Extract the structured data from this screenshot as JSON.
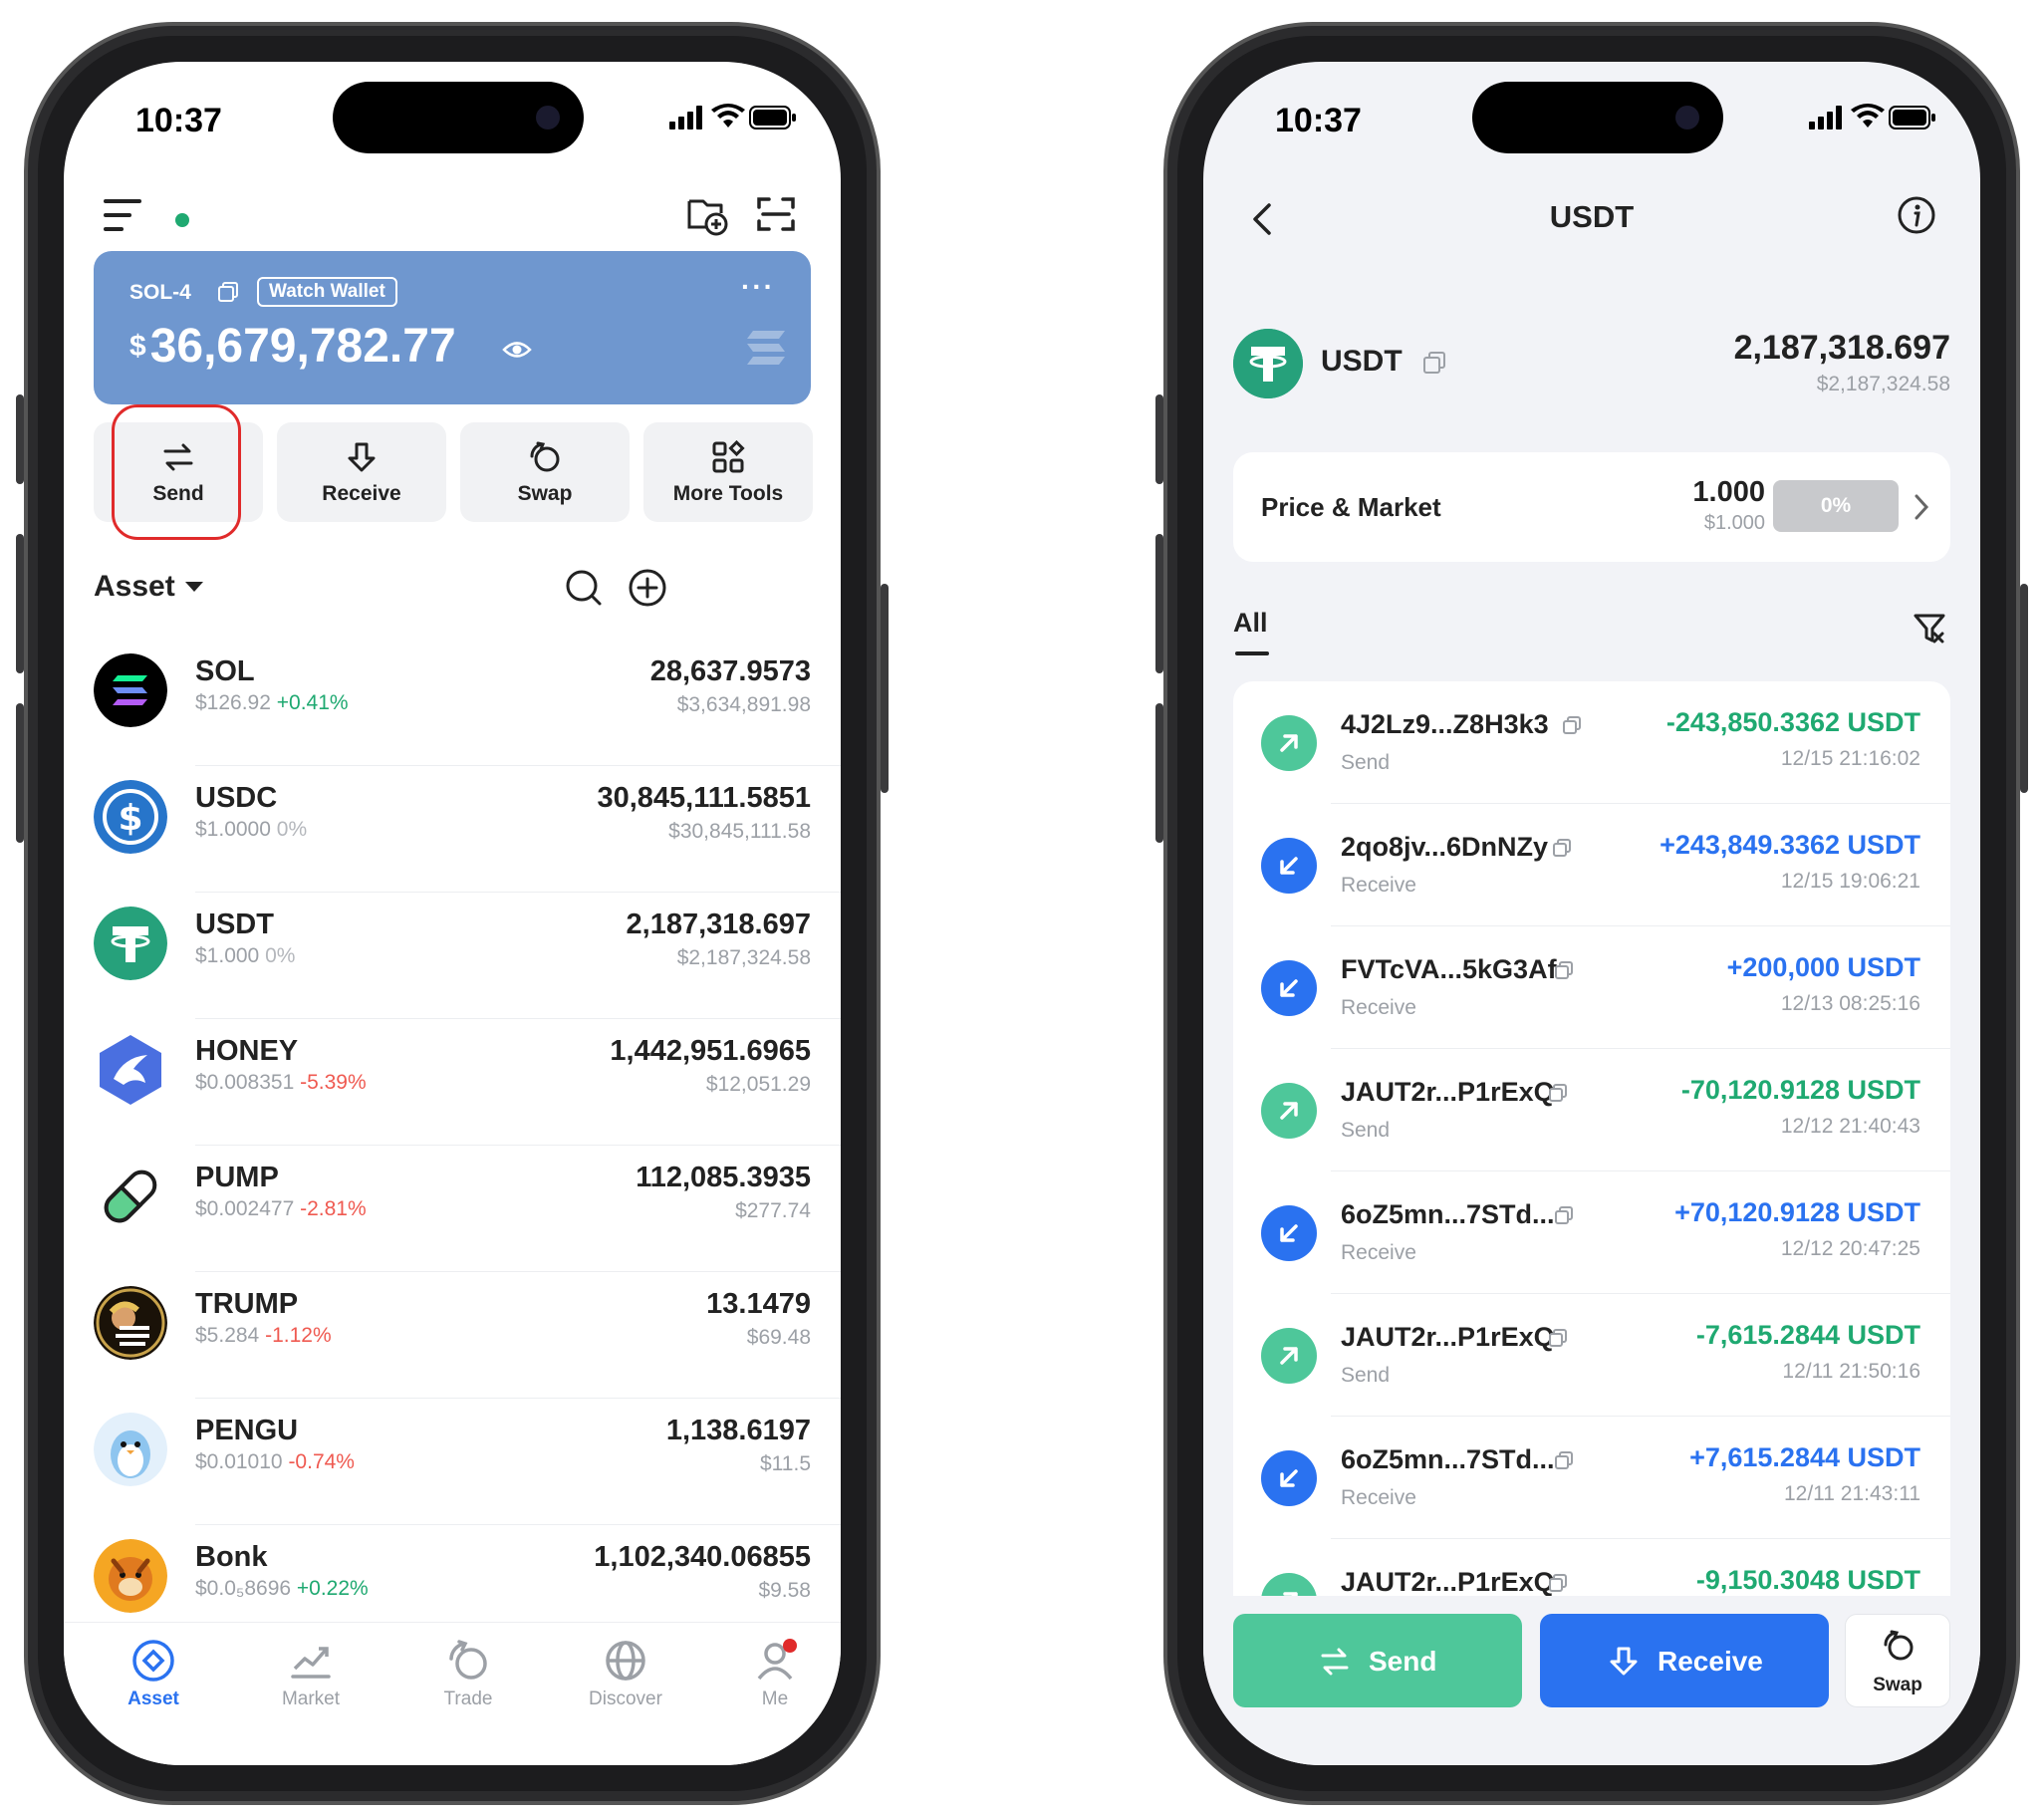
{
  "status_time": "10:37",
  "left": {
    "wallet": {
      "name": "SOL-4",
      "badge": "Watch Wallet",
      "more": "···",
      "currency": "$",
      "balance": "36,679,782.77"
    },
    "actions": [
      "Send",
      "Receive",
      "Swap",
      "More Tools"
    ],
    "asset_header": "Asset",
    "assets": [
      {
        "name": "SOL",
        "price": "$126.92",
        "change": "+0.41%",
        "dir": "pos",
        "amount": "28,637.9573",
        "value": "$3,634,891.98",
        "icon": "solana-icon"
      },
      {
        "name": "USDC",
        "price": "$1.0000",
        "change": "0%",
        "dir": "flat",
        "amount": "30,845,111.5851",
        "value": "$30,845,111.58",
        "icon": "usdc-icon"
      },
      {
        "name": "USDT",
        "price": "$1.000",
        "change": "0%",
        "dir": "flat",
        "amount": "2,187,318.697",
        "value": "$2,187,324.58",
        "icon": "tether-icon"
      },
      {
        "name": "HONEY",
        "price": "$0.008351",
        "change": "-5.39%",
        "dir": "neg",
        "amount": "1,442,951.6965",
        "value": "$12,051.29",
        "icon": "honey-icon"
      },
      {
        "name": "PUMP",
        "price": "$0.002477",
        "change": "-2.81%",
        "dir": "neg",
        "amount": "112,085.3935",
        "value": "$277.74",
        "icon": "pill-icon"
      },
      {
        "name": "TRUMP",
        "price": "$5.284",
        "change": "-1.12%",
        "dir": "neg",
        "amount": "13.1479",
        "value": "$69.48",
        "icon": "trump-icon"
      },
      {
        "name": "PENGU",
        "price": "$0.01010",
        "change": "-0.74%",
        "dir": "neg",
        "amount": "1,138.6197",
        "value": "$11.5",
        "icon": "penguin-icon"
      },
      {
        "name": "Bonk",
        "price": "$0.0₅8696",
        "change": "+0.22%",
        "dir": "pos",
        "amount": "1,102,340.06855",
        "value": "$9.58",
        "icon": "bonk-icon"
      }
    ],
    "nav": [
      "Asset",
      "Market",
      "Trade",
      "Discover",
      "Me"
    ]
  },
  "right": {
    "title": "USDT",
    "token": {
      "name": "USDT",
      "amount": "2,187,318.697",
      "value": "$2,187,324.58"
    },
    "price_market": {
      "label": "Price & Market",
      "price": "1.000",
      "usd": "$1.000",
      "change": "0%"
    },
    "tab": "All",
    "transactions": [
      {
        "addr": "4J2Lz9...Z8H3k3",
        "type": "Send",
        "amount": "-243,850.3362 USDT",
        "time": "12/15 21:16:02",
        "dir": "send"
      },
      {
        "addr": "2qo8jv...6DnNZy",
        "type": "Receive",
        "amount": "+243,849.3362 USDT",
        "time": "12/15 19:06:21",
        "dir": "recv"
      },
      {
        "addr": "FVTcVA...5kG3Af",
        "type": "Receive",
        "amount": "+200,000 USDT",
        "time": "12/13 08:25:16",
        "dir": "recv"
      },
      {
        "addr": "JAUT2r...P1rExQ",
        "type": "Send",
        "amount": "-70,120.9128 USDT",
        "time": "12/12 21:40:43",
        "dir": "send"
      },
      {
        "addr": "6oZ5mn...7STd...",
        "type": "Receive",
        "amount": "+70,120.9128 USDT",
        "time": "12/12 20:47:25",
        "dir": "recv"
      },
      {
        "addr": "JAUT2r...P1rExQ",
        "type": "Send",
        "amount": "-7,615.2844 USDT",
        "time": "12/11 21:50:16",
        "dir": "send"
      },
      {
        "addr": "6oZ5mn...7STd...",
        "type": "Receive",
        "amount": "+7,615.2844 USDT",
        "time": "12/11 21:43:11",
        "dir": "recv"
      },
      {
        "addr": "JAUT2r...P1rExQ",
        "type": "Send",
        "amount": "-9,150.3048 USDT",
        "time": "",
        "dir": "send"
      }
    ],
    "buttons": {
      "send": "Send",
      "receive": "Receive",
      "swap": "Swap"
    }
  },
  "colors": {
    "green": "#1fa971",
    "blue": "#2a72f0",
    "red": "#ef5a51",
    "card": "#6f97cf",
    "tether": "#26a17b"
  }
}
